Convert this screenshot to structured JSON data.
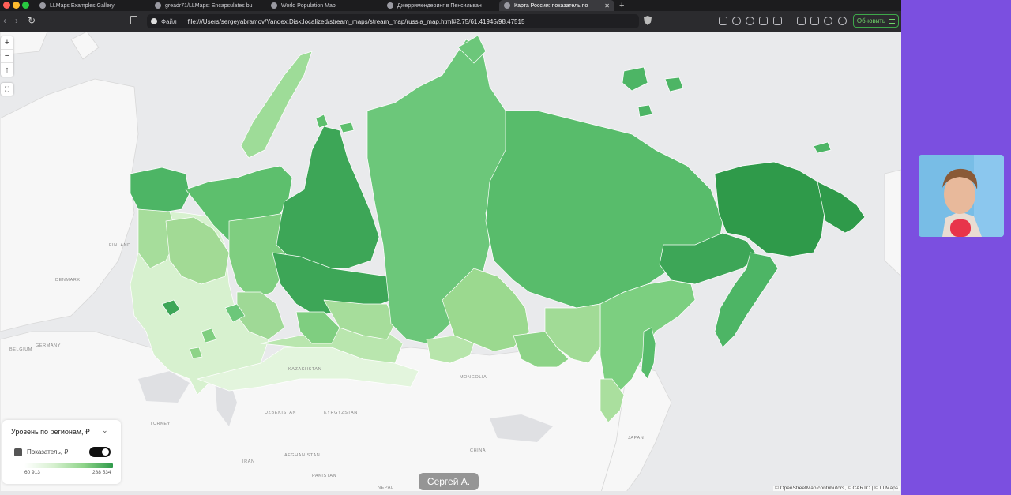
{
  "browser": {
    "tabs": [
      {
        "title": "LLMaps Examples Gallery",
        "active": false
      },
      {
        "title": "greadr71/LLMaps: Encapsulates bu",
        "active": false
      },
      {
        "title": "World Population Map",
        "active": false
      },
      {
        "title": "Джерримендеринг в Пенсильван",
        "active": false
      },
      {
        "title": "Карта России: показатель по",
        "active": true
      }
    ],
    "url_scheme": "Файл",
    "url": "file:///Users/sergeyabramov/Yandex.Disk.localized/stream_maps/stream_map/russia_map.html#2.75/61.41945/98.47515",
    "update_button": "Обновить"
  },
  "map": {
    "zoom_in": "+",
    "zoom_out": "−",
    "compass": "↑",
    "fullscreen": "⛶",
    "labels": {
      "finland": "FINLAND",
      "denmark": "DENMARK",
      "belgium": "BELGIUM",
      "germany": "GERMANY",
      "turkey": "TURKEY",
      "kazakhstan": "KAZAKHSTAN",
      "uzbekistan": "UZBEKISTAN",
      "kyrgyzstan": "KYRGYZSTAN",
      "mongolia": "MONGOLIA",
      "afghanistan": "AFGHANISTAN",
      "iran": "IRAN",
      "pakistan": "PAKISTAN",
      "china": "CHINA",
      "japan": "JAPAN",
      "nepal": "NEPAL"
    },
    "attribution": "© OpenStreetMap contributors, © CARTO | © LLMaps"
  },
  "legend": {
    "title": "Уровень по регионам, ₽",
    "metric_label": "Показатель, ₽",
    "min_value": "60 913",
    "max_value": "288 534",
    "toggle_on": true
  },
  "caption": "Сергей А.",
  "colors": {
    "darkest_green": "#2f9a4a",
    "dark_green": "#4db565",
    "mid_green": "#6cc77a",
    "light_green": "#9bd98f",
    "pale_green": "#c9ecbf"
  }
}
